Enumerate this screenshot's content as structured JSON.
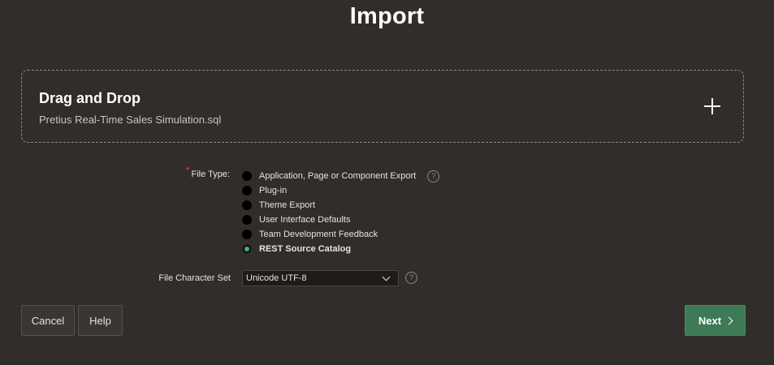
{
  "page": {
    "title": "Import"
  },
  "dropzone": {
    "title": "Drag and Drop",
    "file_name": "Pretius Real-Time Sales Simulation.sql",
    "add_icon": "plus-icon"
  },
  "file_type": {
    "label": "File Type:",
    "required_mark": "*",
    "options": [
      {
        "label": "Application, Page or Component Export",
        "selected": false
      },
      {
        "label": "Plug-in",
        "selected": false
      },
      {
        "label": "Theme Export",
        "selected": false
      },
      {
        "label": "User Interface Defaults",
        "selected": false
      },
      {
        "label": "Team Development Feedback",
        "selected": false
      },
      {
        "label": "REST Source Catalog",
        "selected": true
      }
    ],
    "help_icon": "help-icon"
  },
  "charset": {
    "label": "File Character Set",
    "value": "Unicode UTF-8",
    "help_icon": "help-icon"
  },
  "buttons": {
    "cancel": "Cancel",
    "help": "Help",
    "next": "Next"
  },
  "colors": {
    "background": "#312d2a",
    "primary_button": "#3d7a55",
    "selected_radio": "#4caf78",
    "required": "#e5473d"
  }
}
